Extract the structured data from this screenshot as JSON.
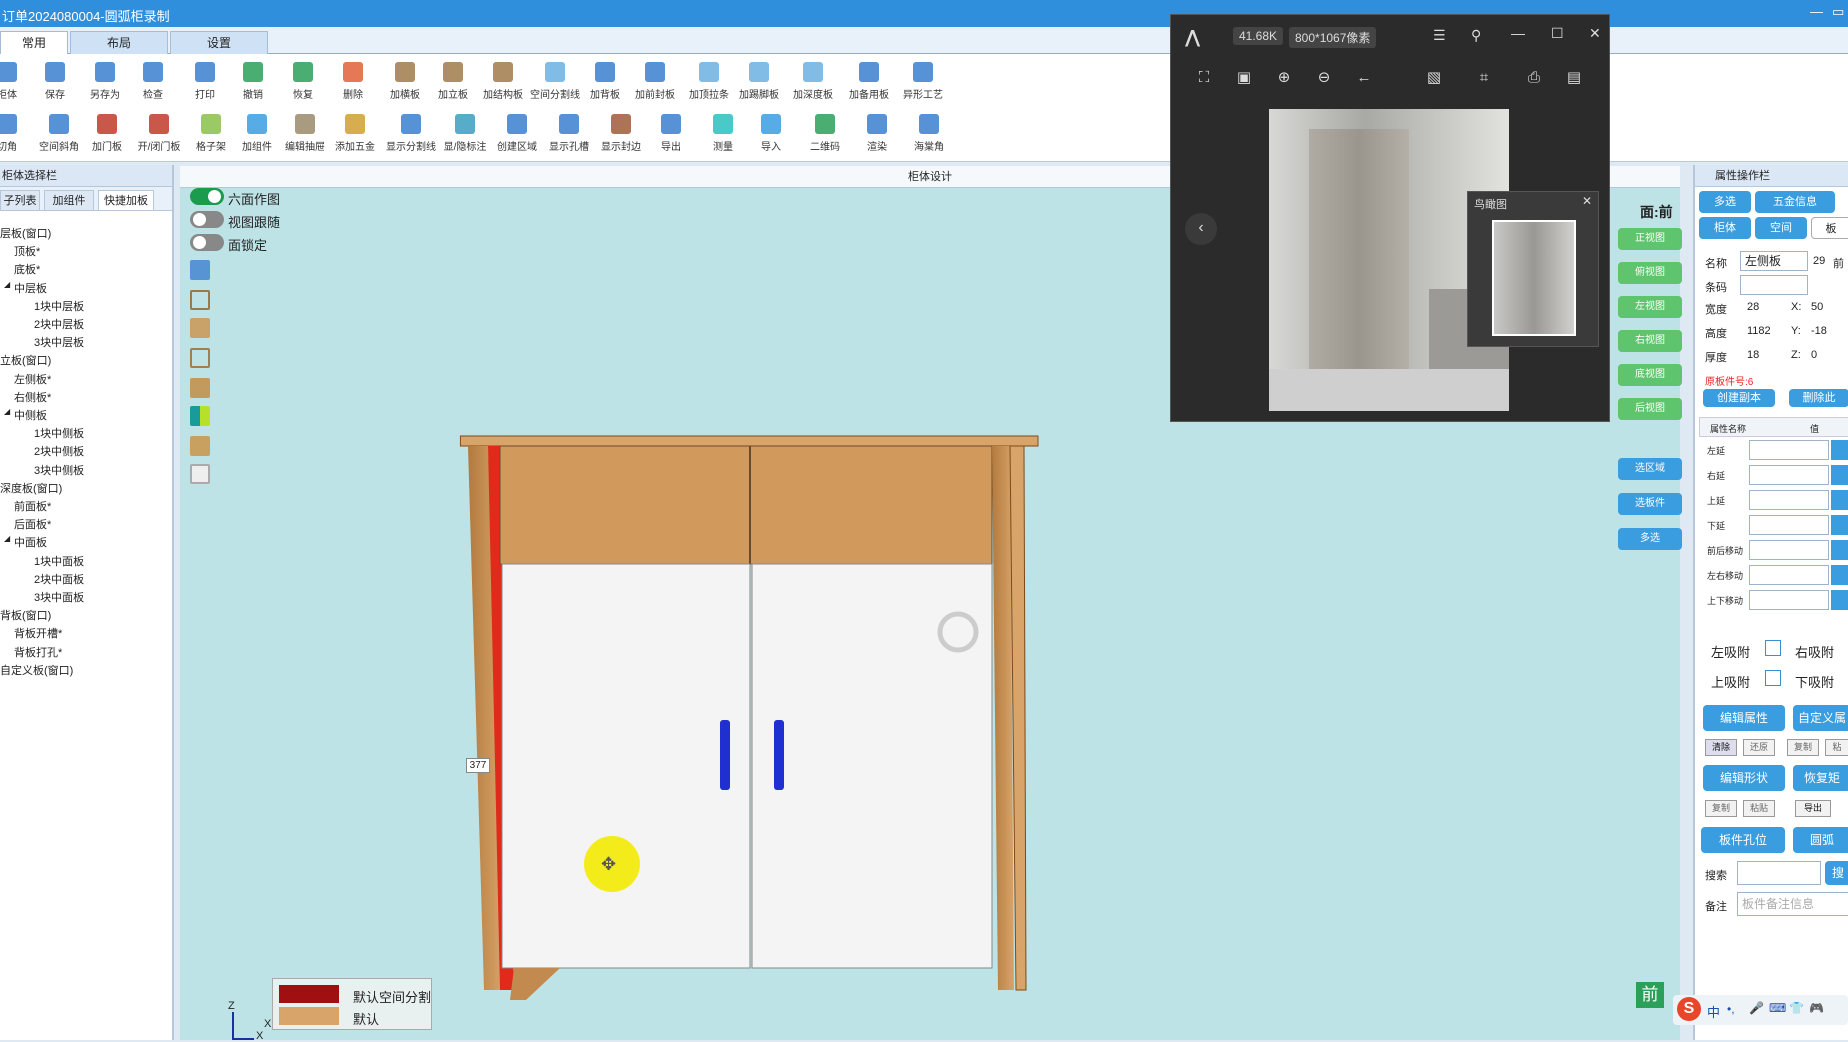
{
  "window": {
    "title": "订单2024080004-圆弧柜录制"
  },
  "tabs": [
    "常用",
    "布局",
    "设置"
  ],
  "ribbon_row1": [
    "柜体",
    "保存",
    "另存为",
    "检查",
    "打印",
    "撤销",
    "恢复",
    "删除",
    "加横板",
    "加立板",
    "加结构板",
    "空间分割线",
    "加背板",
    "加前封板",
    "加顶拉条",
    "加踢脚板",
    "加深度板",
    "加备用板",
    "异形工艺"
  ],
  "ribbon_row2": [
    "切角",
    "空间斜角",
    "加门板",
    "开/闭门板",
    "格子架",
    "加组件",
    "编辑抽屉",
    "添加五金",
    "显示分割线",
    "显/隐标注",
    "创建区域",
    "显示孔槽",
    "显示封边",
    "导出",
    "测量",
    "导入",
    "二维码",
    "渲染",
    "海棠角"
  ],
  "left_panel": {
    "header": "柜体选择栏",
    "subtabs": [
      "子列表",
      "加组件",
      "快捷加板"
    ],
    "tree": [
      {
        "label": "层板(窗口)",
        "level": 0
      },
      {
        "label": "顶板*",
        "level": 1
      },
      {
        "label": "底板*",
        "level": 1
      },
      {
        "label": "中层板",
        "level": 1,
        "expander": "◢"
      },
      {
        "label": "1块中层板",
        "level": 2
      },
      {
        "label": "2块中层板",
        "level": 2
      },
      {
        "label": "3块中层板",
        "level": 2
      },
      {
        "label": "立板(窗口)",
        "level": 0
      },
      {
        "label": "左侧板*",
        "level": 1
      },
      {
        "label": "右侧板*",
        "level": 1
      },
      {
        "label": "中侧板",
        "level": 1,
        "expander": "◢"
      },
      {
        "label": "1块中侧板",
        "level": 2
      },
      {
        "label": "2块中侧板",
        "level": 2
      },
      {
        "label": "3块中侧板",
        "level": 2
      },
      {
        "label": "深度板(窗口)",
        "level": 0
      },
      {
        "label": "前面板*",
        "level": 1
      },
      {
        "label": "后面板*",
        "level": 1
      },
      {
        "label": "中面板",
        "level": 1,
        "expander": "◢"
      },
      {
        "label": "1块中面板",
        "level": 2
      },
      {
        "label": "2块中面板",
        "level": 2
      },
      {
        "label": "3块中面板",
        "level": 2
      },
      {
        "label": "背板(窗口)",
        "level": 0
      },
      {
        "label": "背板开槽*",
        "level": 1
      },
      {
        "label": "背板打孔*",
        "level": 1
      },
      {
        "label": "自定义板(窗口)",
        "level": 0
      }
    ]
  },
  "canvas": {
    "header": "柜体设计",
    "toggles": [
      {
        "label": "六面作图",
        "on": true
      },
      {
        "label": "视图跟随",
        "on": false
      },
      {
        "label": "面锁定",
        "on": false
      }
    ],
    "face_label": "面:前",
    "view_buttons": [
      "正视图",
      "俯视图",
      "左视图",
      "右视图",
      "底视图",
      "后视图"
    ],
    "select_buttons": [
      "选区域",
      "选板件",
      "多选"
    ],
    "dimension_tag": "377",
    "axis": {
      "z": "Z",
      "x1": "X",
      "x2": "X"
    },
    "legend": [
      {
        "label": "默认空间分割",
        "color": "#a01010"
      },
      {
        "label": "默认",
        "color": "#d9a46a"
      }
    ],
    "front_indicator": "前"
  },
  "right_panel": {
    "header": "属性操作栏",
    "tabs_row1": [
      "多选",
      "五金信息"
    ],
    "tabs_row2": [
      "柜体",
      "空间",
      "板"
    ],
    "name_label": "名称",
    "name_value": "左侧板",
    "name_extra": "29",
    "name_extra2": "前",
    "barcode_label": "条码",
    "width_label": "宽度",
    "width_value": "28",
    "x_label": "X:",
    "x_value": "50",
    "height_label": "高度",
    "height_value": "1182",
    "y_label": "Y:",
    "y_value": "-18",
    "thick_label": "厚度",
    "thick_value": "18",
    "z_label": "Z:",
    "z_value": "0",
    "orig_part": "原板件号:6",
    "create_copy": "创建副本",
    "delete_copy": "删除此",
    "attr_header": [
      "属性名称",
      "值"
    ],
    "attrs": [
      "左延",
      "右延",
      "上延",
      "下延",
      "前后移动",
      "左右移动",
      "上下移动"
    ],
    "attach": [
      "左吸附",
      "右吸附",
      "上吸附",
      "下吸附"
    ],
    "edit_attr": "编辑属性",
    "custom_attr": "自定义属",
    "small1": [
      "清除",
      "还原",
      "复制",
      "粘"
    ],
    "edit_shape": "编辑形状",
    "restore_shape": "恢复矩",
    "small2": [
      "复制",
      "粘贴",
      "导出"
    ],
    "hole_pos": "板件孔位",
    "arc_btn": "圆弧",
    "search_label": "搜索",
    "search_btn": "搜",
    "note_label": "备注",
    "note_placeholder": "板件备注信息"
  },
  "image_viewer": {
    "size": "41.68K",
    "resolution": "800*1067像素",
    "thumbnail_title": "鸟瞰图"
  },
  "ime_bar": [
    "S",
    "中",
    "•,",
    "🎤",
    "⌨",
    "👕",
    "🎮"
  ]
}
